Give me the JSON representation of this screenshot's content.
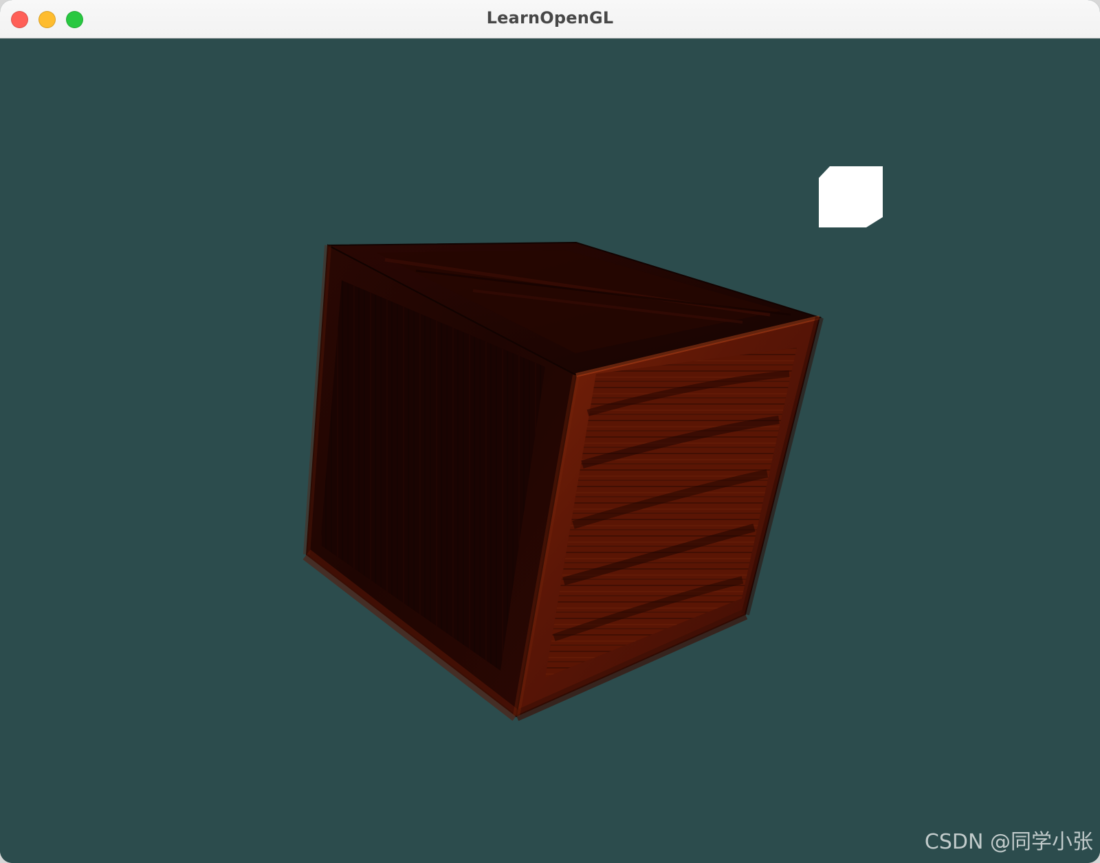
{
  "window": {
    "title": "LearnOpenGL",
    "controls": {
      "close_icon": "close-icon",
      "minimize_icon": "minimize-icon",
      "zoom_icon": "zoom-icon"
    }
  },
  "scene": {
    "background_color": "#2c4c4d",
    "objects": [
      {
        "name": "wooden-crate",
        "description": "textured wooden crate cube",
        "color": "#5b1606"
      },
      {
        "name": "light-cube",
        "description": "small white light source cube",
        "color": "#ffffff"
      }
    ]
  },
  "watermark": {
    "text": "CSDN @同学小张"
  }
}
